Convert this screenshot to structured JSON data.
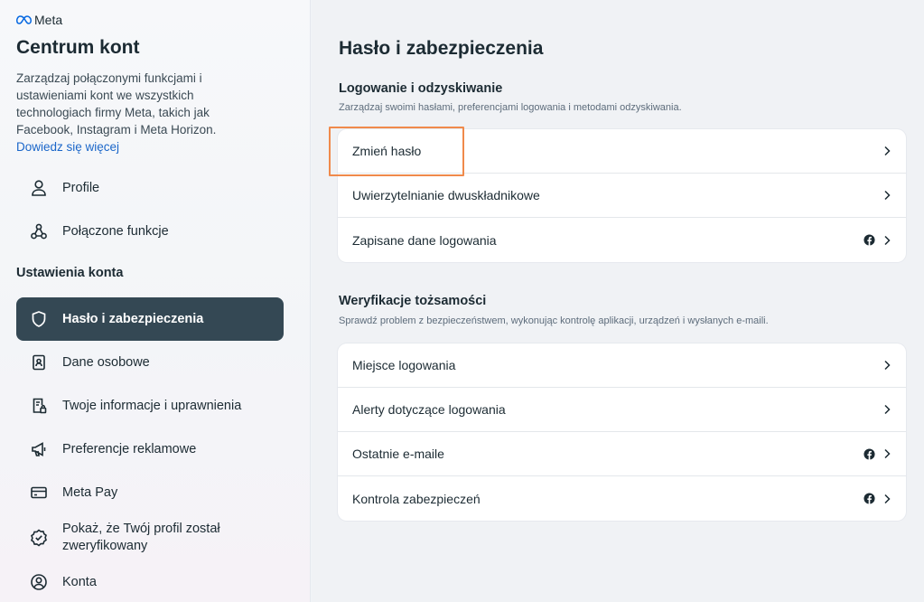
{
  "sidebar": {
    "brand": "Meta",
    "title": "Centrum kont",
    "description": "Zarządzaj połączonymi funkcjami i ustawieniami kont we wszystkich technologiach firmy Meta, takich jak Facebook, Instagram i Meta Horizon.",
    "learn_more": "Dowiedz się więcej",
    "top_items": [
      {
        "label": "Profile",
        "icon": "person-icon"
      },
      {
        "label": "Połączone funkcje",
        "icon": "connected-nodes-icon"
      }
    ],
    "section_heading": "Ustawienia konta",
    "settings_items": [
      {
        "label": "Hasło i zabezpieczenia",
        "icon": "shield-icon",
        "active": true
      },
      {
        "label": "Dane osobowe",
        "icon": "id-card-icon"
      },
      {
        "label": "Twoje informacje i uprawnienia",
        "icon": "document-lock-icon"
      },
      {
        "label": "Preferencje reklamowe",
        "icon": "megaphone-icon"
      },
      {
        "label": "Meta Pay",
        "icon": "credit-card-icon"
      },
      {
        "label": "Pokaż, że Twój profil został zweryfikowany",
        "icon": "verified-badge-icon"
      },
      {
        "label": "Konta",
        "icon": "account-circle-icon"
      }
    ],
    "active_color": "#344854"
  },
  "main": {
    "title": "Hasło i zabezpieczenia",
    "login_section": {
      "title": "Logowanie i odzyskiwanie",
      "description": "Zarządzaj swoimi hasłami, preferencjami logowania i metodami odzyskiwania.",
      "rows": [
        {
          "label": "Zmień hasło",
          "fb": false
        },
        {
          "label": "Uwierzytelnianie dwuskładnikowe",
          "fb": false
        },
        {
          "label": "Zapisane dane logowania",
          "fb": true
        }
      ]
    },
    "verify_section": {
      "title": "Weryfikacje tożsamości",
      "description": "Sprawdź problem z bezpieczeństwem, wykonując kontrolę aplikacji, urządzeń i wysłanych e-maili.",
      "rows": [
        {
          "label": "Miejsce logowania",
          "fb": false
        },
        {
          "label": "Alerty dotyczące logowania",
          "fb": false
        },
        {
          "label": "Ostatnie e-maile",
          "fb": true
        },
        {
          "label": "Kontrola zabezpieczeń",
          "fb": true
        }
      ]
    },
    "highlight_color": "#f08a4b"
  }
}
